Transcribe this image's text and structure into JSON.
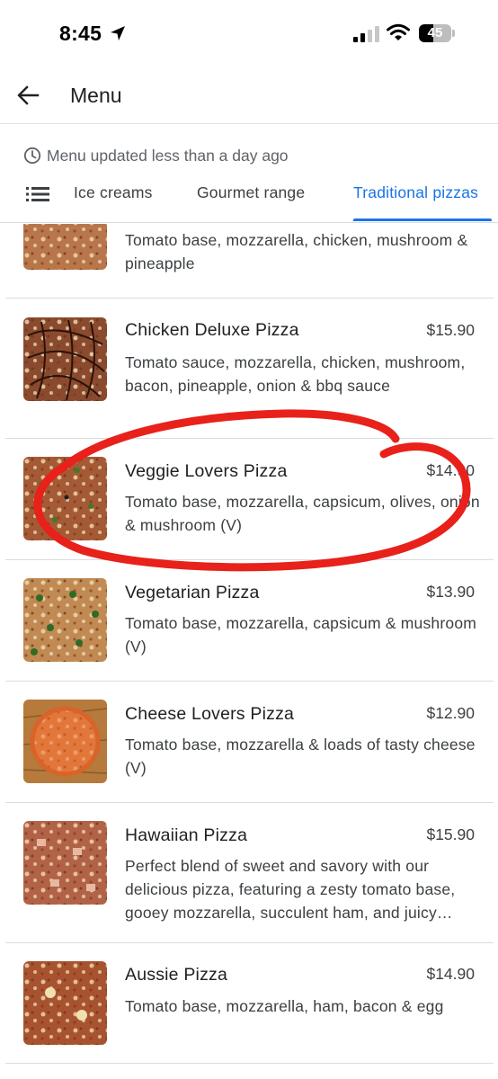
{
  "status_bar": {
    "time": "8:45",
    "battery_level": "45",
    "battery_fraction": 0.45
  },
  "header": {
    "title": "Menu",
    "back_icon": "arrow-left-icon"
  },
  "menu_info": {
    "updated_text": "Menu updated less than a day ago",
    "icon": "clock-icon"
  },
  "tabs": {
    "menu_icon": "list-icon",
    "items": [
      {
        "label": "Ice creams",
        "active": false
      },
      {
        "label": "Gourmet range",
        "active": false
      },
      {
        "label": "Traditional pizzas",
        "active": true
      }
    ],
    "accent_color": "#1a73e8"
  },
  "items": [
    {
      "name": "",
      "price": "",
      "description": "Tomato base, mozzarella, chicken, mushroom & pineapple"
    },
    {
      "name": "Chicken Deluxe Pizza",
      "price": "$15.90",
      "description": "Tomato sauce, mozzarella, chicken, mushroom, bacon, pineapple, onion & bbq sauce"
    },
    {
      "name": "Veggie Lovers Pizza",
      "price": "$14.90",
      "description": "Tomato base, mozzarella, capsicum, olives, onion & mushroom (V)"
    },
    {
      "name": "Vegetarian Pizza",
      "price": "$13.90",
      "description": "Tomato base, mozzarella, capsicum & mushroom (V)"
    },
    {
      "name": "Cheese Lovers Pizza",
      "price": "$12.90",
      "description": "Tomato base, mozzarella & loads of tasty cheese (V)"
    },
    {
      "name": "Hawaiian Pizza",
      "price": "$15.90",
      "description": "Perfect blend of sweet and savory with our delicious pizza, featuring a zesty tomato base, gooey mozzarella, succulent ham, and juicy pineapple"
    },
    {
      "name": "Aussie Pizza",
      "price": "$14.90",
      "description": "Tomato base, mozzarella, ham, bacon & egg"
    }
  ],
  "annotation": {
    "color": "#e8211a",
    "highlighted_item": "Veggie Lovers Pizza"
  }
}
